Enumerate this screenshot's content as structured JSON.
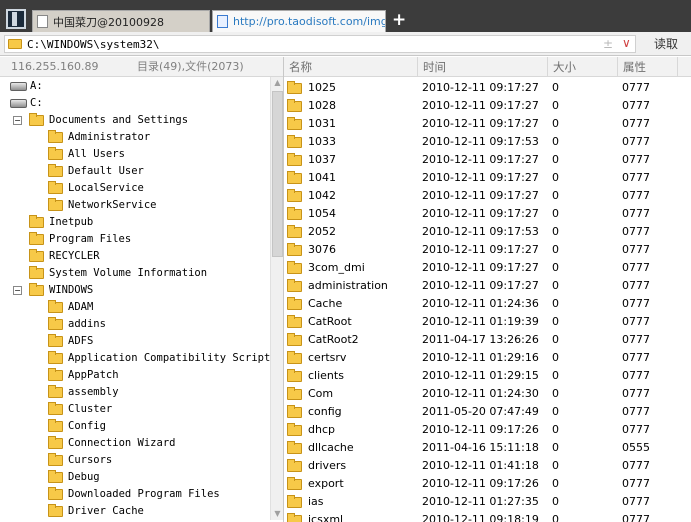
{
  "tabs": [
    {
      "label": "中国菜刀@20100928",
      "active": false
    },
    {
      "label": "http://pro.taodisoft.com/img/i...",
      "active": true
    }
  ],
  "new_tab_label": "+",
  "address": {
    "path": "C:\\WINDOWS\\system32\\",
    "plusminus": "±",
    "chevron": "∨",
    "read_label": "读取"
  },
  "left_header": {
    "ip": "116.255.160.89",
    "stats": "目录(49),文件(2073)"
  },
  "tree": [
    {
      "type": "drive",
      "label": "A:"
    },
    {
      "type": "drive",
      "label": "C:"
    },
    {
      "type": "folder",
      "label": "Documents and Settings",
      "expander": "−"
    },
    {
      "type": "folder",
      "label": "Administrator"
    },
    {
      "type": "folder",
      "label": "All Users"
    },
    {
      "type": "folder",
      "label": "Default User"
    },
    {
      "type": "folder",
      "label": "LocalService"
    },
    {
      "type": "folder",
      "label": "NetworkService"
    },
    {
      "type": "folder",
      "label": "Inetpub"
    },
    {
      "type": "folder",
      "label": "Program Files"
    },
    {
      "type": "folder",
      "label": "RECYCLER"
    },
    {
      "type": "folder",
      "label": "System Volume Information"
    },
    {
      "type": "folder",
      "label": "WINDOWS",
      "expander": "−"
    },
    {
      "type": "folder",
      "label": "ADAM"
    },
    {
      "type": "folder",
      "label": "addins"
    },
    {
      "type": "folder",
      "label": "ADFS"
    },
    {
      "type": "folder",
      "label": "Application Compatibility Scripts"
    },
    {
      "type": "folder",
      "label": "AppPatch"
    },
    {
      "type": "folder",
      "label": "assembly"
    },
    {
      "type": "folder",
      "label": "Cluster"
    },
    {
      "type": "folder",
      "label": "Config"
    },
    {
      "type": "folder",
      "label": "Connection Wizard"
    },
    {
      "type": "folder",
      "label": "Cursors"
    },
    {
      "type": "folder",
      "label": "Debug"
    },
    {
      "type": "folder",
      "label": "Downloaded Program Files"
    },
    {
      "type": "folder",
      "label": "Driver Cache"
    }
  ],
  "columns": {
    "name": "名称",
    "time": "时间",
    "size": "大小",
    "attr": "属性"
  },
  "files": [
    {
      "name": "1025",
      "time": "2010-12-11 09:17:27",
      "size": "0",
      "attr": "0777"
    },
    {
      "name": "1028",
      "time": "2010-12-11 09:17:27",
      "size": "0",
      "attr": "0777"
    },
    {
      "name": "1031",
      "time": "2010-12-11 09:17:27",
      "size": "0",
      "attr": "0777"
    },
    {
      "name": "1033",
      "time": "2010-12-11 09:17:53",
      "size": "0",
      "attr": "0777"
    },
    {
      "name": "1037",
      "time": "2010-12-11 09:17:27",
      "size": "0",
      "attr": "0777"
    },
    {
      "name": "1041",
      "time": "2010-12-11 09:17:27",
      "size": "0",
      "attr": "0777"
    },
    {
      "name": "1042",
      "time": "2010-12-11 09:17:27",
      "size": "0",
      "attr": "0777"
    },
    {
      "name": "1054",
      "time": "2010-12-11 09:17:27",
      "size": "0",
      "attr": "0777"
    },
    {
      "name": "2052",
      "time": "2010-12-11 09:17:53",
      "size": "0",
      "attr": "0777"
    },
    {
      "name": "3076",
      "time": "2010-12-11 09:17:27",
      "size": "0",
      "attr": "0777"
    },
    {
      "name": "3com_dmi",
      "time": "2010-12-11 09:17:27",
      "size": "0",
      "attr": "0777"
    },
    {
      "name": "administration",
      "time": "2010-12-11 09:17:27",
      "size": "0",
      "attr": "0777"
    },
    {
      "name": "Cache",
      "time": "2010-12-11 01:24:36",
      "size": "0",
      "attr": "0777"
    },
    {
      "name": "CatRoot",
      "time": "2010-12-11 01:19:39",
      "size": "0",
      "attr": "0777"
    },
    {
      "name": "CatRoot2",
      "time": "2011-04-17 13:26:26",
      "size": "0",
      "attr": "0777"
    },
    {
      "name": "certsrv",
      "time": "2010-12-11 01:29:16",
      "size": "0",
      "attr": "0777"
    },
    {
      "name": "clients",
      "time": "2010-12-11 01:29:15",
      "size": "0",
      "attr": "0777"
    },
    {
      "name": "Com",
      "time": "2010-12-11 01:24:30",
      "size": "0",
      "attr": "0777"
    },
    {
      "name": "config",
      "time": "2011-05-20 07:47:49",
      "size": "0",
      "attr": "0777"
    },
    {
      "name": "dhcp",
      "time": "2010-12-11 09:17:26",
      "size": "0",
      "attr": "0777"
    },
    {
      "name": "dllcache",
      "time": "2011-04-16 15:11:18",
      "size": "0",
      "attr": "0555"
    },
    {
      "name": "drivers",
      "time": "2010-12-11 01:41:18",
      "size": "0",
      "attr": "0777"
    },
    {
      "name": "export",
      "time": "2010-12-11 09:17:26",
      "size": "0",
      "attr": "0777"
    },
    {
      "name": "ias",
      "time": "2010-12-11 01:27:35",
      "size": "0",
      "attr": "0777"
    },
    {
      "name": "icsxml",
      "time": "2010-12-11 09:18:19",
      "size": "0",
      "attr": "0777"
    }
  ]
}
